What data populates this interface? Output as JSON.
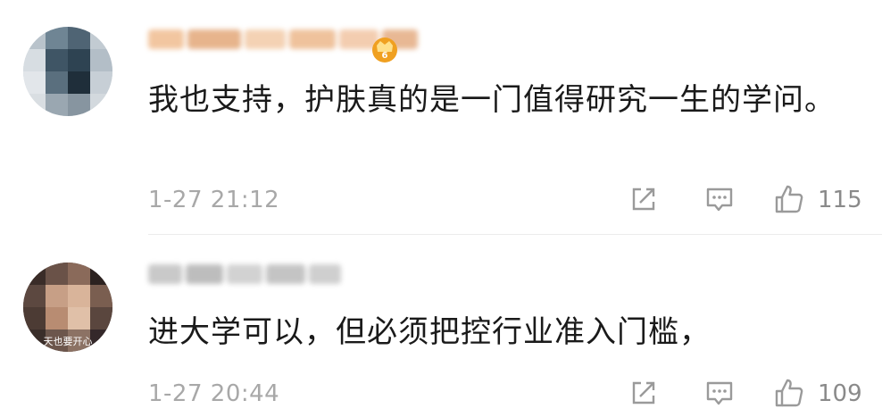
{
  "comments": [
    {
      "text": "我也支持，护肤真的是一门值得研究一生的学问。",
      "timestamp": "1-27 21:12",
      "likes": "115",
      "avatar_icon": "blurred-avatar",
      "badge_icon": "vip-crown-badge-icon"
    },
    {
      "text": "进大学可以，但必须把控行业准入门槛，",
      "timestamp": "1-27 20:44",
      "likes": "109",
      "avatar_icon": "blurred-avatar",
      "avatar_caption": "天也要开心"
    }
  ],
  "icons": {
    "share": "share-icon",
    "reply": "comment-icon",
    "like": "thumbs-up-icon"
  },
  "colors": {
    "text": "#1a1a1a",
    "meta": "#a8a8a8",
    "count": "#8a8a8a",
    "icon": "#9a9a9a",
    "badge": "#f0a020"
  }
}
